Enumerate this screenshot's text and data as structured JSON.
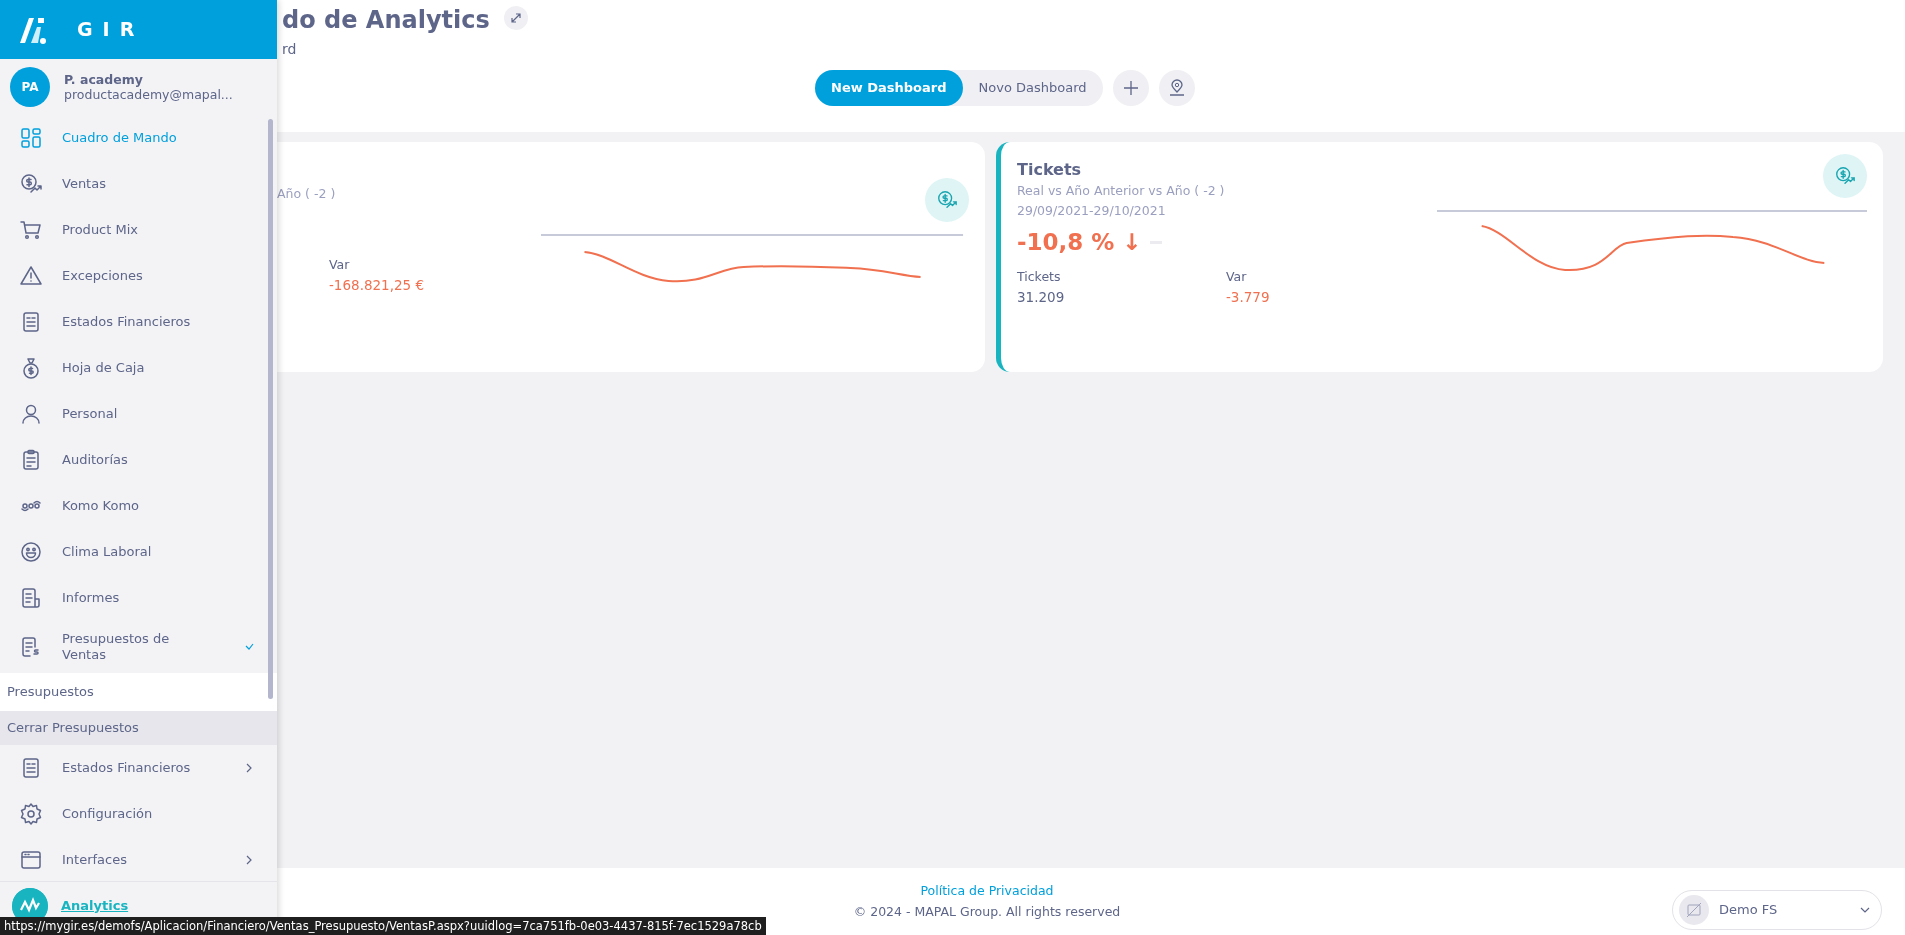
{
  "sidebar": {
    "logo_text": "GIR",
    "user": {
      "initials": "PA",
      "name": "P. academy",
      "email": "productacademy@mapal..."
    },
    "items": [
      {
        "label": "Cuadro de Mando",
        "selected": true
      },
      {
        "label": "Ventas",
        "selected": false
      },
      {
        "label": "Product Mix",
        "selected": false
      },
      {
        "label": "Excepciones",
        "selected": false
      },
      {
        "label": "Estados Financieros",
        "selected": false
      },
      {
        "label": "Hoja de Caja",
        "selected": false
      },
      {
        "label": "Personal",
        "selected": false
      },
      {
        "label": "Auditorías",
        "selected": false
      },
      {
        "label": "Komo Komo",
        "selected": false
      },
      {
        "label": "Clima Laboral",
        "selected": false
      },
      {
        "label": "Informes",
        "selected": false
      },
      {
        "label": "Presupuestos de Ventas",
        "selected": false,
        "expanded": true,
        "children": [
          {
            "label": "Presupuestos",
            "selected": true
          },
          {
            "label": "Cerrar Presupuestos",
            "selected": false
          }
        ]
      },
      {
        "label": "Estados Financieros",
        "selected": false,
        "expanded": false
      },
      {
        "label": "Configuración",
        "selected": false
      },
      {
        "label": "Interfaces",
        "selected": false,
        "expanded": false
      }
    ],
    "app": {
      "label": "Analytics"
    }
  },
  "header": {
    "title": "do de Analytics",
    "subtitle": "rd",
    "tabs": [
      {
        "label": "New Dashboard",
        "selected": true
      },
      {
        "label": "Novo Dashboard",
        "selected": false
      }
    ]
  },
  "cards": [
    {
      "clipped_left": true,
      "subtitle": "Año ( -2 )",
      "metrics": [
        {
          "label": "Var",
          "value": "-168.821,25 €",
          "negative": true
        }
      ]
    },
    {
      "clipped_left": false,
      "title": "Tickets",
      "subtitle": "Real vs Año Anterior vs Año ( -2 )",
      "date": "29/09/2021-29/10/2021",
      "big_value": "-10,8 % ↓",
      "metrics": [
        {
          "label": "Tickets",
          "value": "31.209",
          "negative": false
        },
        {
          "label": "Var",
          "value": "-3.779",
          "negative": true
        }
      ]
    }
  ],
  "footer": {
    "link": "Política de Privacidad",
    "copyright": "© 2024 - MAPAL Group. All rights reserved",
    "site_select": "Demo FS"
  },
  "status_url": "https://mygir.es/demofs/Aplicacion/Financiero/Ventas_Presupuesto/VentasP.aspx?uuidlog=7ca751fb-0e03-4437-815f-7ec1529a78cb"
}
